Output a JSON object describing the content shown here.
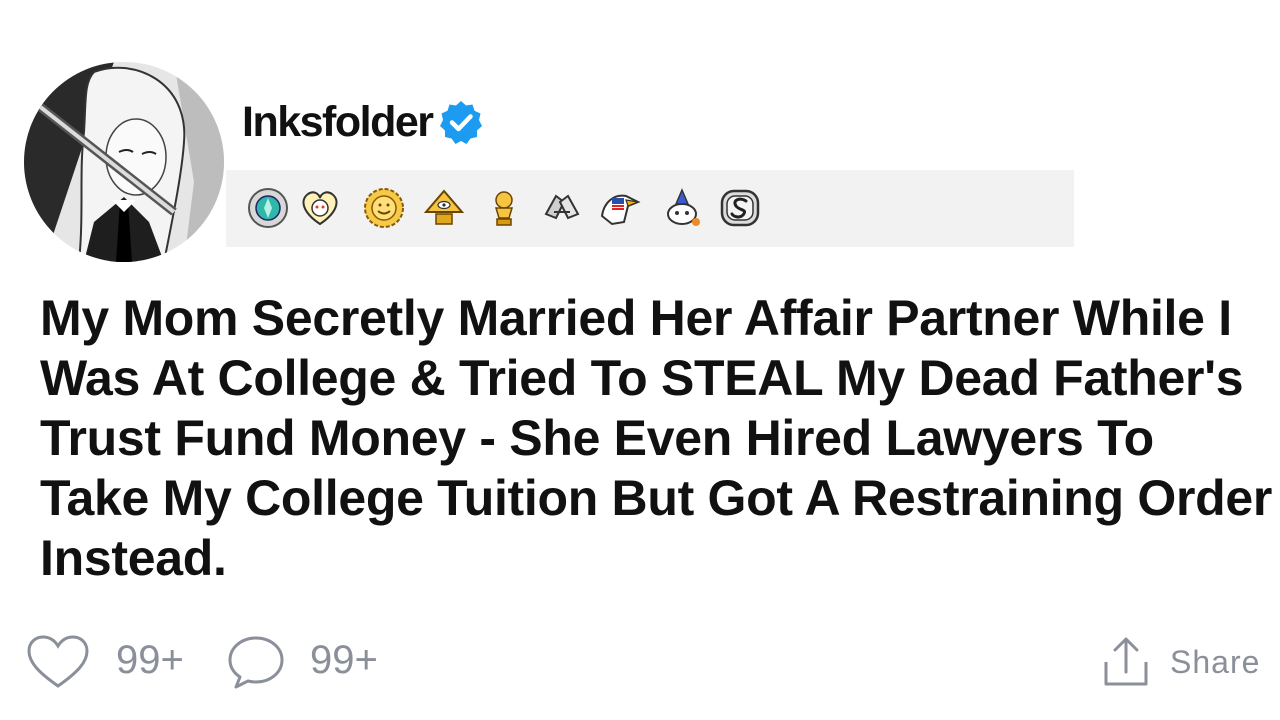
{
  "post": {
    "username": "Inksfolder",
    "verified": true,
    "title": "My Mom Secretly Married Her Affair Partner While I Was At College & Tried To STEAL My Dead Father's Trust Fund Money - She Even Hired Lawyers To Take My College Tuition But Got A Restraining Order Instead.",
    "awards": [
      "silver-gem-award-icon",
      "wholesome-heart-award-icon",
      "gold-sun-award-icon",
      "illuminati-pyramid-award-icon",
      "gold-trophy-award-icon",
      "handshake-award-icon",
      "eagle-flag-award-icon",
      "snoo-party-award-icon",
      "silver-s-award-icon"
    ]
  },
  "actions": {
    "likes": "99+",
    "comments": "99+",
    "share_label": "Share"
  },
  "colors": {
    "text": "#111111",
    "muted": "#8a8f99",
    "verified_blue": "#1d9bf0",
    "award_strip_bg": "#f2f2f2"
  }
}
